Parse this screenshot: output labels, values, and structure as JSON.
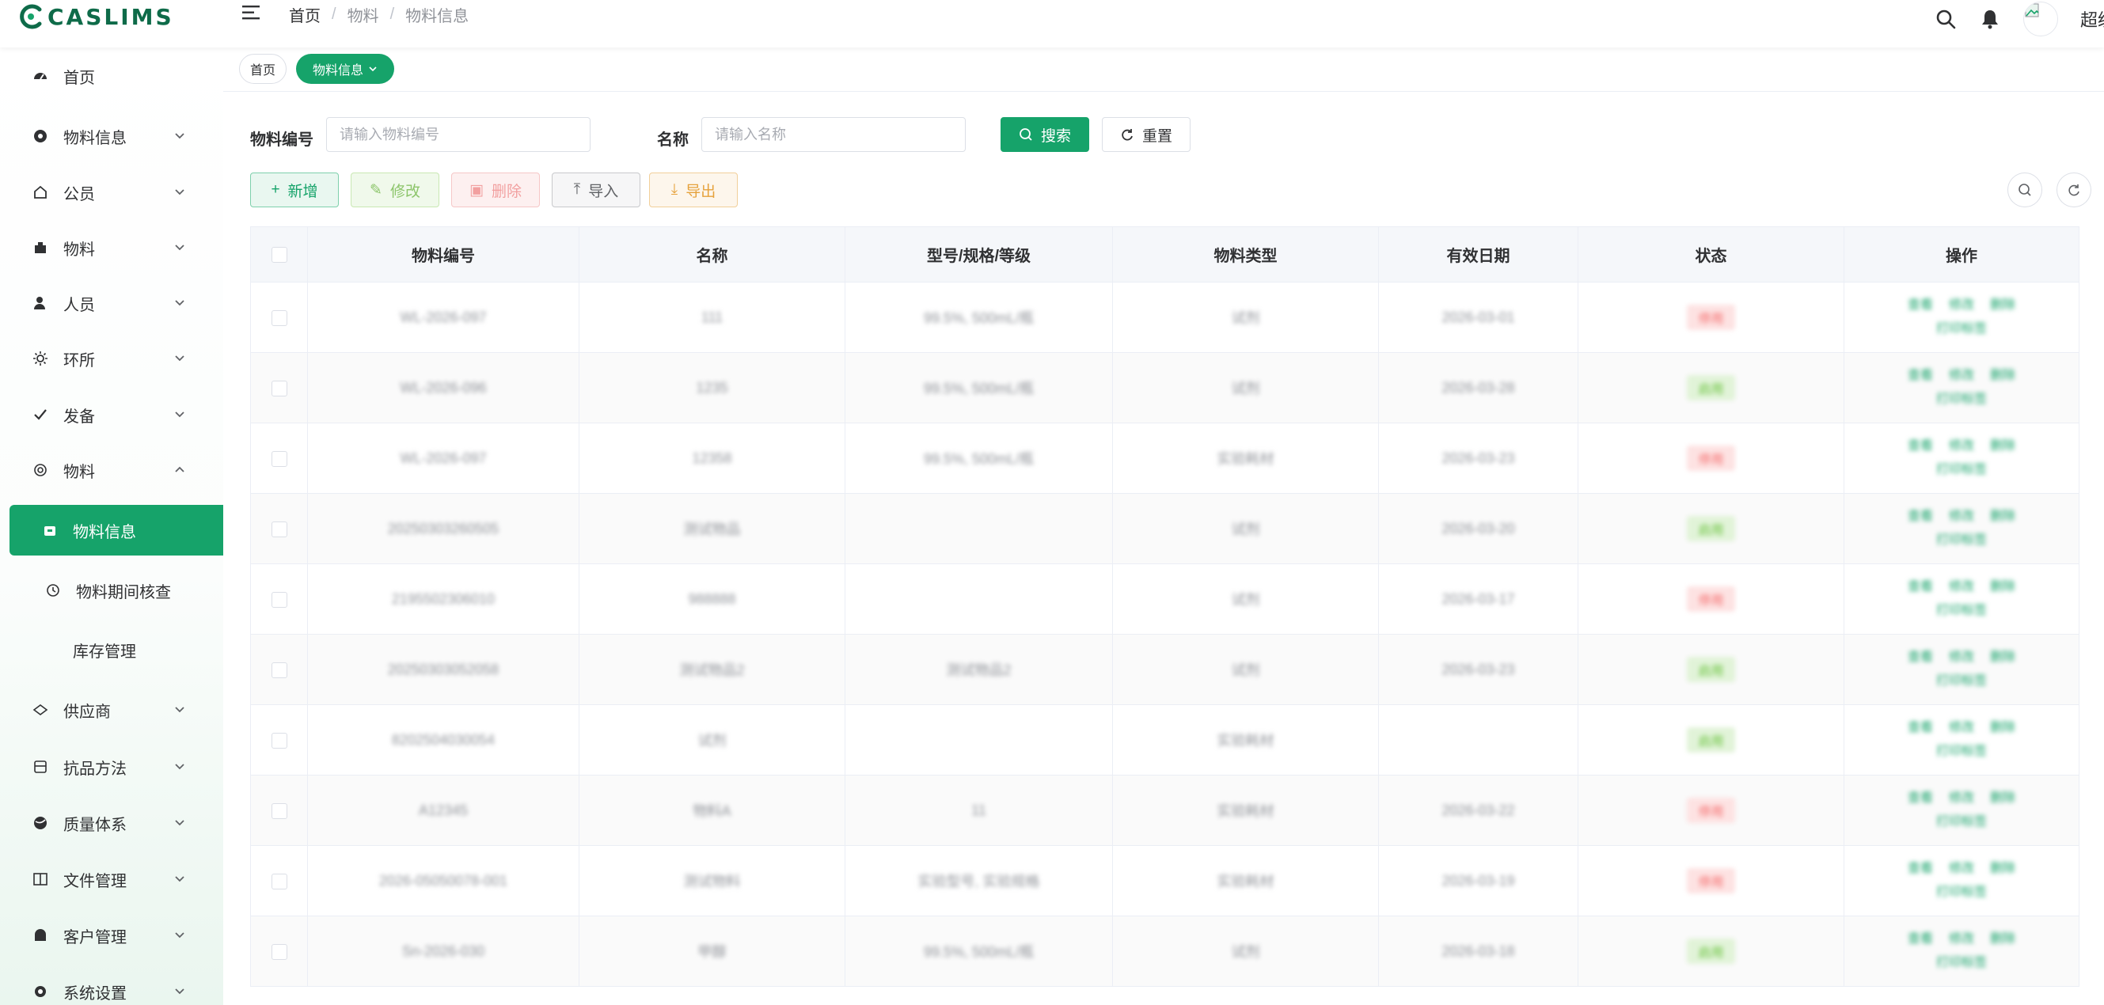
{
  "app": {
    "logo_text": "CASLIMS",
    "brand_color": "#16a36a"
  },
  "header": {
    "breadcrumb": [
      "首页",
      "物料",
      "物料信息"
    ],
    "username": "超级"
  },
  "sidebar": {
    "items": [
      {
        "label": "首页",
        "icon": "dashboard-icon",
        "top": 0
      },
      {
        "label": "物料信息",
        "icon": "aperture-icon"
      },
      {
        "label": "公员",
        "icon": "home-icon"
      },
      {
        "label": "物料",
        "icon": "tool-icon"
      },
      {
        "label": "人员",
        "icon": "user-icon"
      },
      {
        "label": "环所",
        "icon": "sun-icon"
      },
      {
        "label": "发备",
        "icon": "check-icon"
      },
      {
        "label": "物料",
        "icon": "gauge-icon"
      }
    ],
    "subitems": [
      {
        "label": "物料信息",
        "icon": "box-icon",
        "active": true
      },
      {
        "label": "物料期间核查",
        "icon": "clock-icon"
      },
      {
        "label": "库存管理",
        "icon": ""
      }
    ],
    "lower_items": [
      {
        "label": "供应商",
        "icon": "supplier-icon"
      },
      {
        "label": "抗品方法",
        "icon": "method-icon"
      },
      {
        "label": "质量体系",
        "icon": "globe-icon"
      },
      {
        "label": "文件管理",
        "icon": "book-icon"
      },
      {
        "label": "客户管理",
        "icon": "contact-icon"
      },
      {
        "label": "系统设置",
        "icon": "settings-icon"
      }
    ]
  },
  "tags": {
    "home": "首页",
    "current": "物料信息"
  },
  "search": {
    "code_label": "物料编号",
    "code_placeholder": "请输入物料编号",
    "name_label": "名称",
    "name_placeholder": "请输入名称",
    "search_btn": "搜索",
    "reset_btn": "重置"
  },
  "toolbar": {
    "add": "新增",
    "edit": "修改",
    "delete": "删除",
    "import": "导入",
    "export": "导出"
  },
  "table": {
    "headers": [
      "物料编号",
      "名称",
      "型号/规格/等级",
      "物料类型",
      "有效日期",
      "状态",
      "操作"
    ],
    "rows": [
      {
        "code": "WL-2026-097",
        "name": "111",
        "spec": "99.5%, 500mL/瓶",
        "type": "试剂",
        "date": "2026-03-01",
        "status": "停用",
        "status_color": "red"
      },
      {
        "code": "WL-2026-096",
        "name": "1235",
        "spec": "99.5%, 500mL/瓶",
        "type": "试剂",
        "date": "2026-03-28",
        "status": "启用",
        "status_color": "green"
      },
      {
        "code": "WL-2026-097",
        "name": "12358",
        "spec": "99.5%, 500mL/瓶",
        "type": "实验耗材",
        "date": "2026-03-23",
        "status": "停用",
        "status_color": "red"
      },
      {
        "code": "20250303260505",
        "name": "测试物品",
        "spec": "",
        "type": "试剂",
        "date": "2026-03-20",
        "status": "启用",
        "status_color": "green"
      },
      {
        "code": "2195502306010",
        "name": "988888",
        "spec": "",
        "type": "试剂",
        "date": "2026-03-17",
        "status": "停用",
        "status_color": "red"
      },
      {
        "code": "20250303052058",
        "name": "测试物品2",
        "spec": "测试物品2",
        "type": "试剂",
        "date": "2026-03-23",
        "status": "启用",
        "status_color": "green"
      },
      {
        "code": "8202504030054",
        "name": "试剂",
        "spec": "",
        "type": "实验耗材",
        "date": "",
        "status": "启用",
        "status_color": "green"
      },
      {
        "code": "A12345",
        "name": "物料A",
        "spec": "11",
        "type": "实验耗材",
        "date": "2026-03-22",
        "status": "停用",
        "status_color": "red"
      },
      {
        "code": "2026-05050078-001",
        "name": "测试物料",
        "spec": "实验型号, 实验规格",
        "type": "实验耗材",
        "date": "2026-03-19",
        "status": "停用",
        "status_color": "red"
      },
      {
        "code": "Sn-2026-030",
        "name": "甲醇",
        "spec": "99.5%, 500mL/瓶",
        "type": "试剂",
        "date": "2026-03-18",
        "status": "启用",
        "status_color": "green"
      }
    ],
    "ops": {
      "view": "查看",
      "edit": "修改",
      "delete": "删除",
      "print": "打印标签"
    }
  }
}
